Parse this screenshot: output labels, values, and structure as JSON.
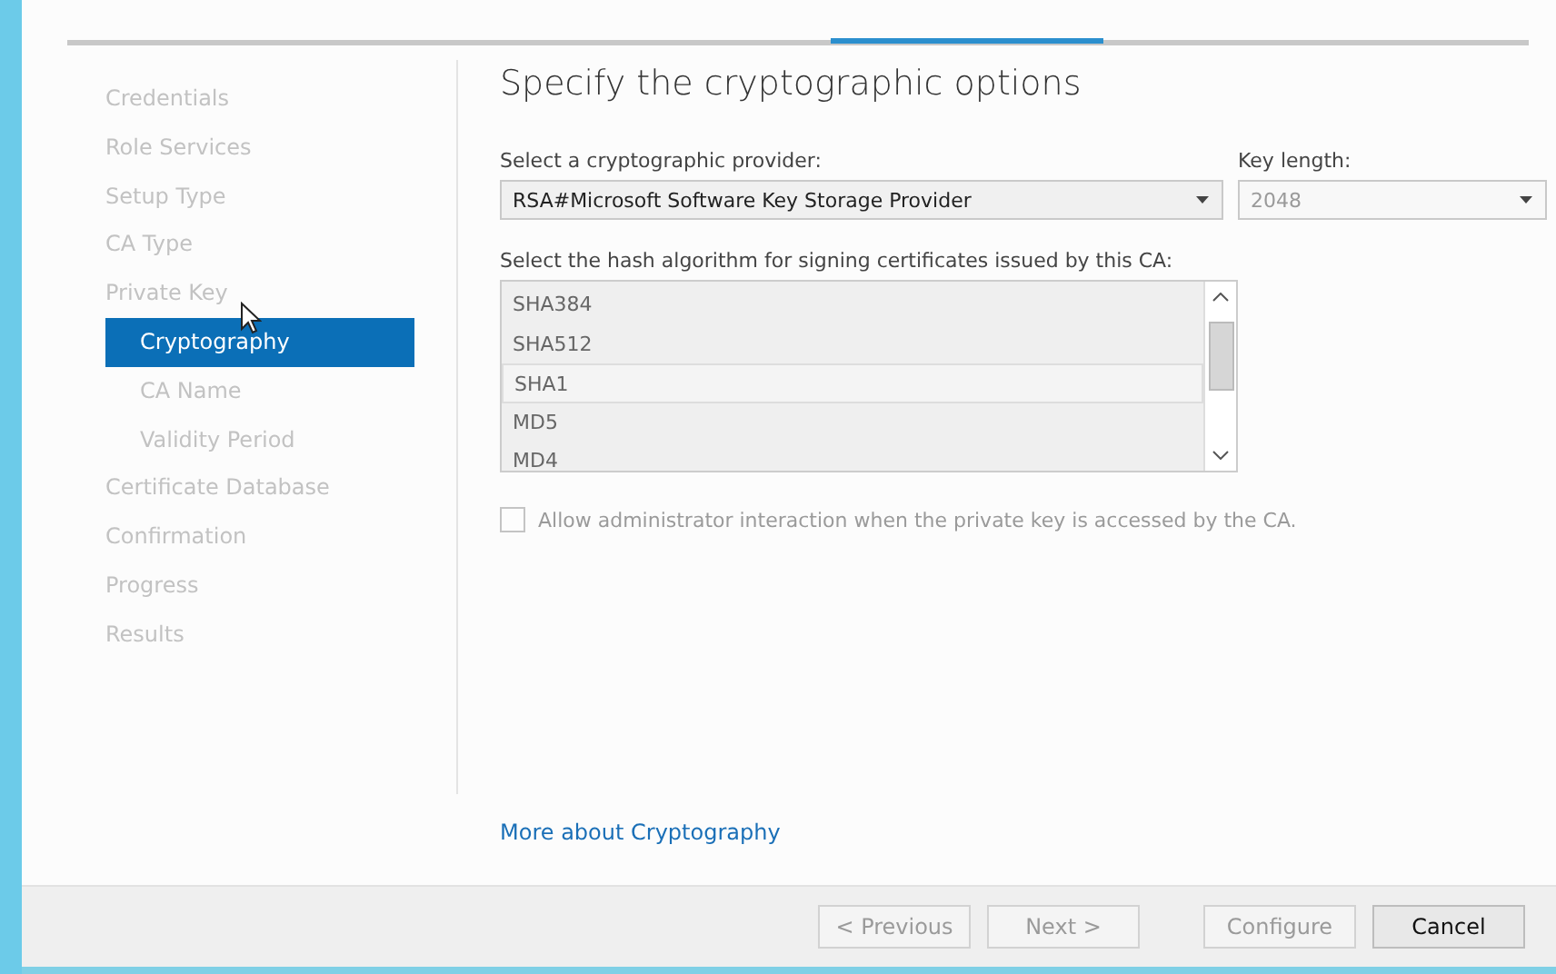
{
  "nav": {
    "items": [
      {
        "label": "Credentials",
        "selected": false
      },
      {
        "label": "Role Services",
        "selected": false
      },
      {
        "label": "Setup Type",
        "selected": false
      },
      {
        "label": "CA Type",
        "selected": false
      },
      {
        "label": "Private Key",
        "selected": false,
        "children": [
          {
            "label": "Cryptography",
            "selected": true
          },
          {
            "label": "CA Name",
            "selected": false
          },
          {
            "label": "Validity Period",
            "selected": false
          }
        ]
      },
      {
        "label": "Certificate Database",
        "selected": false
      },
      {
        "label": "Confirmation",
        "selected": false
      },
      {
        "label": "Progress",
        "selected": false
      },
      {
        "label": "Results",
        "selected": false
      }
    ]
  },
  "page_title": "Specify the cryptographic options",
  "provider": {
    "label": "Select a cryptographic provider:",
    "value": "RSA#Microsoft Software Key Storage Provider",
    "disabled": false
  },
  "key_length": {
    "label": "Key length:",
    "value": "2048",
    "disabled": true
  },
  "hash": {
    "label": "Select the hash algorithm for signing certificates issued by this CA:",
    "disabled": true,
    "items": [
      {
        "label": "SHA384",
        "selected": false
      },
      {
        "label": "SHA512",
        "selected": false
      },
      {
        "label": "SHA1",
        "selected": true
      },
      {
        "label": "MD5",
        "selected": false
      },
      {
        "label": "MD4",
        "selected": false
      }
    ]
  },
  "admin_checkbox": {
    "label": "Allow administrator interaction when the private key is accessed by the CA.",
    "checked": false,
    "disabled": true
  },
  "more_link": "More about Cryptography",
  "buttons": [
    {
      "label": "< Previous",
      "disabled": true
    },
    {
      "label": "Next >",
      "disabled": true
    },
    {
      "label": "Configure",
      "disabled": true
    },
    {
      "label": "Cancel",
      "disabled": false
    }
  ]
}
